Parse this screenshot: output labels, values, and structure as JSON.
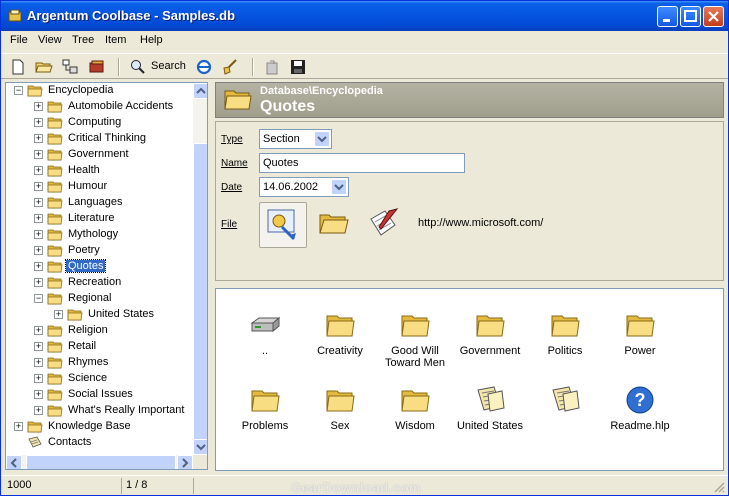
{
  "window": {
    "title": "Argentum Coolbase - Samples.db"
  },
  "menu": [
    "File",
    "View",
    "Tree",
    "Item",
    "Help"
  ],
  "toolbar": {
    "search_label": "Search"
  },
  "tree": {
    "root": "Encyclopedia",
    "children": [
      "Automobile Accidents",
      "Computing",
      "Critical Thinking",
      "Government",
      "Health",
      "Humour",
      "Languages",
      "Literature",
      "Mythology",
      "Poetry",
      "Quotes",
      "Recreation",
      "Regional",
      "United States",
      "Religion",
      "Retail",
      "Rhymes",
      "Science",
      "Social Issues",
      "What's Really Important"
    ],
    "bottom": [
      "Knowledge Base",
      "Contacts"
    ],
    "selected": "Quotes"
  },
  "header": {
    "path": "Database\\Encyclopedia",
    "title": "Quotes"
  },
  "props": {
    "type_label": "Type",
    "type_value": "Section",
    "name_label": "Name",
    "name_value": "Quotes",
    "date_label": "Date",
    "date_value": "14.06.2002",
    "file_label": "File",
    "url": "http://www.microsoft.com/"
  },
  "files": [
    {
      "name": "..",
      "icon": "drive-icon"
    },
    {
      "name": "Creativity",
      "icon": "folder-icon"
    },
    {
      "name": "Good Will Toward Men",
      "icon": "folder-icon"
    },
    {
      "name": "Government",
      "icon": "folder-icon"
    },
    {
      "name": "Politics",
      "icon": "folder-icon"
    },
    {
      "name": "Power",
      "icon": "folder-icon"
    },
    {
      "name": "Problems",
      "icon": "folder-icon"
    },
    {
      "name": "Sex",
      "icon": "folder-icon"
    },
    {
      "name": "Wisdom",
      "icon": "folder-icon"
    },
    {
      "name": "United States",
      "icon": "notes-icon"
    },
    {
      "name": "",
      "icon": "notes-icon"
    },
    {
      "name": "Readme.hlp",
      "icon": "help-icon"
    }
  ],
  "status": {
    "count": "1000",
    "position": "1 / 8"
  },
  "watermark": "GearDownload.com",
  "colors": {
    "selection": "#316ac5",
    "titlebar": "#0454e0",
    "folder": "#f5d67a"
  }
}
